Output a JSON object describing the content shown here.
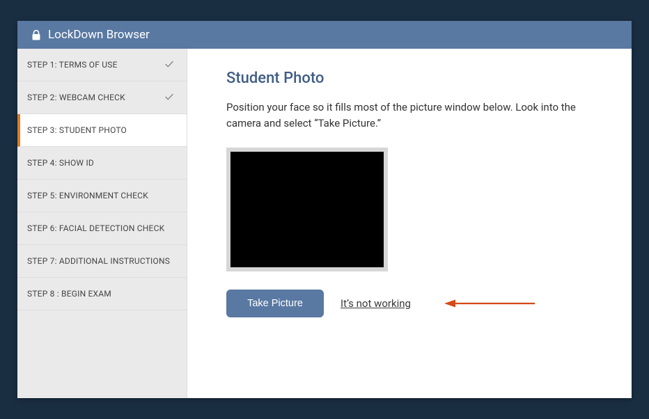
{
  "header": {
    "title": "LockDown Browser"
  },
  "sidebar": {
    "items": [
      {
        "label": "STEP 1: TERMS OF USE",
        "completed": true
      },
      {
        "label": "STEP 2: WEBCAM CHECK",
        "completed": true
      },
      {
        "label": "STEP 3: STUDENT PHOTO",
        "active": true
      },
      {
        "label": "STEP 4: SHOW ID"
      },
      {
        "label": "STEP 5: ENVIRONMENT CHECK"
      },
      {
        "label": "STEP 6: FACIAL DETECTION CHECK"
      },
      {
        "label": "STEP 7: ADDITIONAL INSTRUCTIONS"
      },
      {
        "label": "STEP 8 : BEGIN EXAM"
      }
    ]
  },
  "main": {
    "title": "Student Photo",
    "instructions": "Position your face so it fills most of the picture window below. Look into the camera and select “Take Picture.”",
    "take_picture_label": "Take Picture",
    "not_working_label": "It’s not working"
  },
  "colors": {
    "accent": "#5978a2",
    "active_marker": "#e27a1b",
    "arrow": "#d44a16"
  }
}
